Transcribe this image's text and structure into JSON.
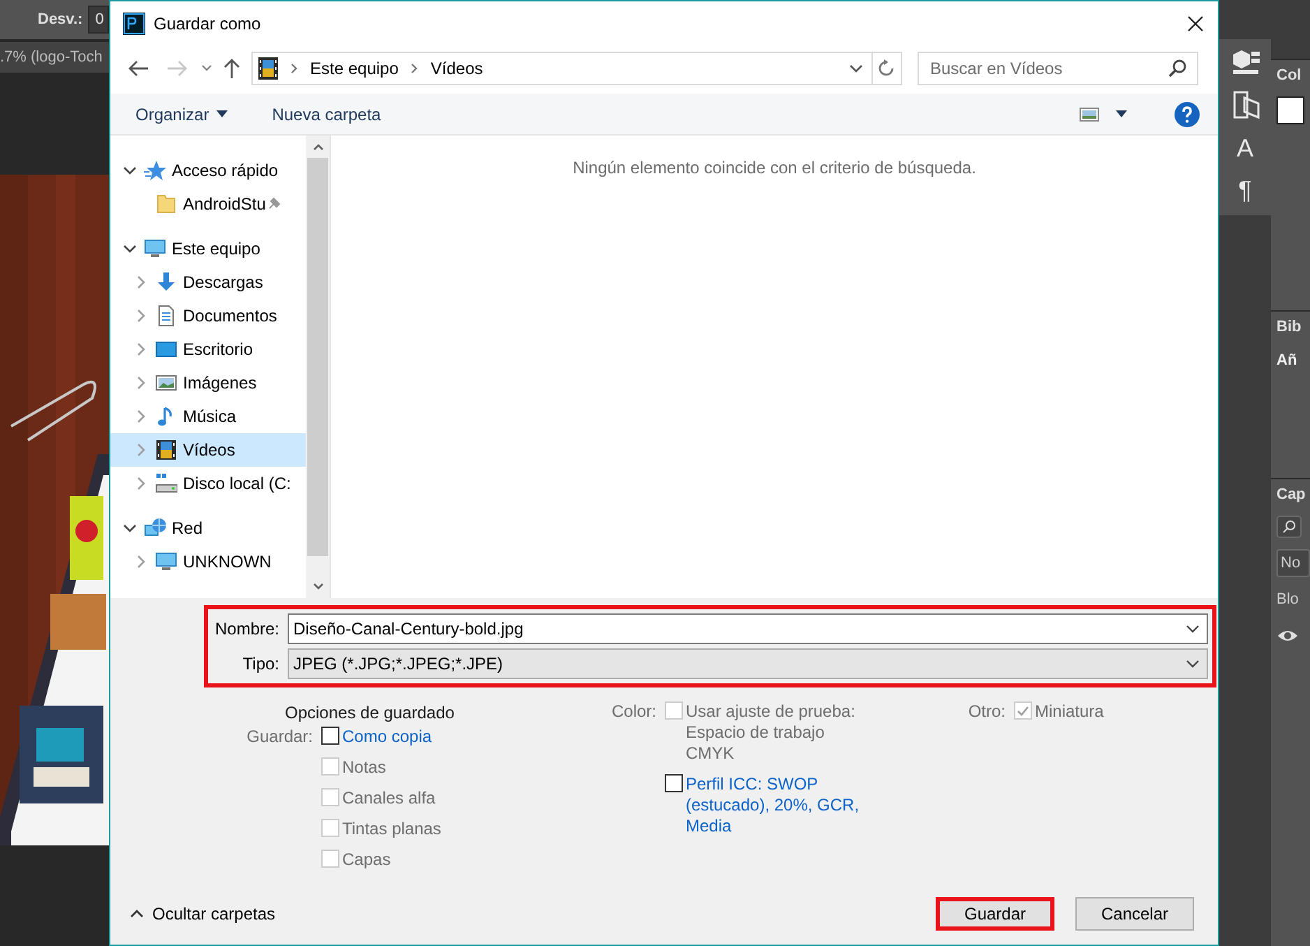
{
  "photoshop": {
    "options_bar": {
      "label": "Desv.:",
      "value": "0"
    },
    "document_tab": ".7% (logo-Toch",
    "dock_glyphs": [
      "A",
      "¶"
    ],
    "panels": [
      {
        "title": "Col"
      },
      {
        "title": "Bib",
        "content": "Añ"
      },
      {
        "title": "Cap",
        "blend_mode": "No",
        "lock_label": "Blo"
      }
    ]
  },
  "dialog": {
    "title": "Guardar como",
    "breadcrumb": [
      "Este equipo",
      "Vídeos"
    ],
    "search": {
      "placeholder": "Buscar en Vídeos"
    },
    "toolbar": [
      "Organizar",
      "Nueva carpeta"
    ],
    "nav_tree": [
      {
        "label": "Acceso rápido",
        "kind": "star",
        "expanded": true,
        "selected": false,
        "children": [
          {
            "label": "AndroidStu",
            "kind": "folder",
            "pinned": true,
            "selected": false
          }
        ]
      },
      {
        "label": "Este equipo",
        "kind": "pc",
        "expanded": true,
        "selected": false,
        "children": [
          {
            "label": "Descargas",
            "kind": "downloads",
            "expanded": false,
            "selected": false
          },
          {
            "label": "Documentos",
            "kind": "documents",
            "expanded": false,
            "selected": false
          },
          {
            "label": "Escritorio",
            "kind": "desktop",
            "expanded": false,
            "selected": false
          },
          {
            "label": "Imágenes",
            "kind": "pictures",
            "expanded": false,
            "selected": false
          },
          {
            "label": "Música",
            "kind": "music",
            "expanded": false,
            "selected": false
          },
          {
            "label": "Vídeos",
            "kind": "videos",
            "expanded": false,
            "selected": true
          },
          {
            "label": "Disco local (C:",
            "kind": "drive",
            "expanded": false,
            "selected": false
          }
        ]
      },
      {
        "label": "Red",
        "kind": "network",
        "expanded": true,
        "selected": false,
        "children": [
          {
            "label": "UNKNOWN",
            "kind": "computer",
            "expanded": false,
            "selected": false
          }
        ]
      }
    ],
    "empty_message": "Ningún elemento coincide con el criterio de búsqueda.",
    "file_name": {
      "label": "Nombre:",
      "value": "Diseño-Canal-Century-bold.jpg"
    },
    "file_type": {
      "label": "Tipo:",
      "value": "JPEG (*.JPG;*.JPEG;*.JPE)"
    },
    "fields_highlighted": true,
    "save_options": {
      "title": "Opciones de guardado",
      "groups": [
        {
          "label": "Guardar:",
          "options": [
            {
              "lines": [
                "Como copia"
              ],
              "checked": false,
              "disabled": false
            },
            {
              "lines": [
                "Notas"
              ],
              "checked": false,
              "disabled": true
            },
            {
              "lines": [
                "Canales alfa"
              ],
              "checked": false,
              "disabled": true
            },
            {
              "lines": [
                "Tintas planas"
              ],
              "checked": false,
              "disabled": true
            },
            {
              "lines": [
                "Capas"
              ],
              "checked": false,
              "disabled": true
            }
          ]
        },
        {
          "label": "Color:",
          "options": [
            {
              "lines": [
                "Usar ajuste de prueba:",
                "Espacio de trabajo",
                "CMYK"
              ],
              "checked": false,
              "disabled": true
            },
            {
              "lines": [
                "Perfil ICC: SWOP",
                "(estucado), 20%, GCR,",
                "Media"
              ],
              "checked": false,
              "disabled": false
            }
          ]
        },
        {
          "label": "Otro:",
          "options": [
            {
              "lines": [
                "Miniatura"
              ],
              "checked": true,
              "disabled": true
            }
          ]
        }
      ]
    },
    "hide_folders": "Ocultar carpetas",
    "buttons": [
      {
        "label": "Guardar",
        "highlighted": true
      },
      {
        "label": "Cancelar",
        "highlighted": false
      }
    ]
  }
}
